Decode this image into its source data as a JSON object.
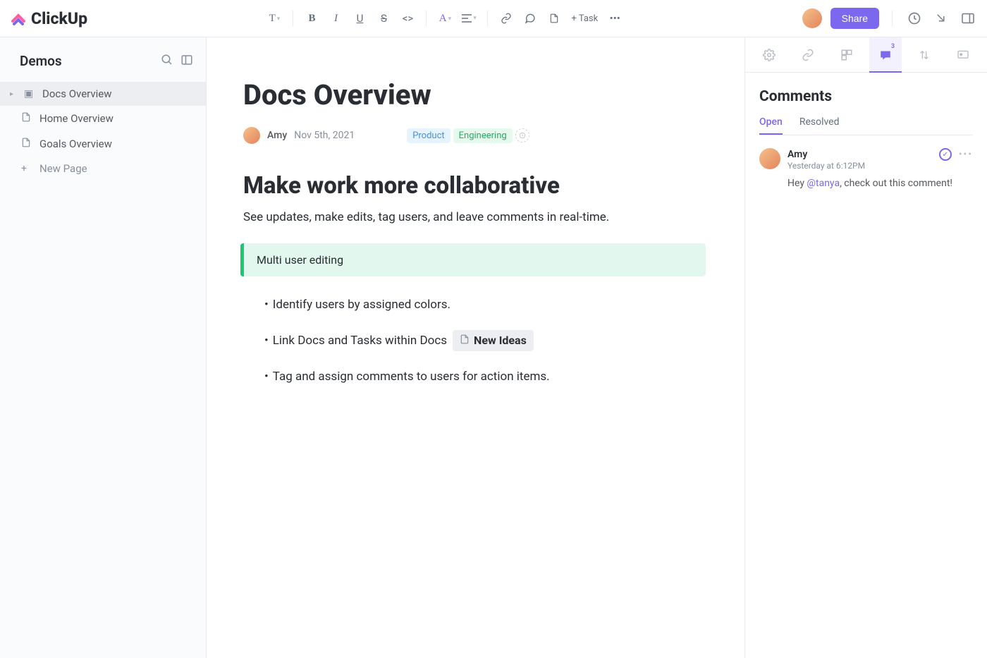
{
  "brand": "ClickUp",
  "toolbar": {
    "add_task": "+ Task"
  },
  "share_label": "Share",
  "sidebar": {
    "space": "Demos",
    "items": [
      {
        "label": "Docs Overview",
        "active": true
      },
      {
        "label": "Home Overview",
        "active": false
      },
      {
        "label": "Goals Overview",
        "active": false
      }
    ],
    "new_page": "New Page"
  },
  "doc": {
    "title": "Docs Overview",
    "author": "Amy",
    "date": "Nov 5th, 2021",
    "tags": {
      "product": "Product",
      "engineering": "Engineering"
    },
    "h2": "Make work more collaborative",
    "paragraph": "See updates, make edits, tag users, and leave comments in real-time.",
    "callout": "Multi user editing",
    "list": [
      "Identify users by assigned colors.",
      "Link Docs and Tasks within Docs",
      "Tag and assign comments to users for action items."
    ],
    "inline_task": "New Ideas"
  },
  "comments": {
    "title": "Comments",
    "tabs": {
      "open": "Open",
      "resolved": "Resolved"
    },
    "badge": "3",
    "item": {
      "author": "Amy",
      "time": "Yesterday at 6:12PM",
      "text_pre": "Hey ",
      "mention": "@tanya",
      "text_post": ", check out this comment!"
    }
  }
}
